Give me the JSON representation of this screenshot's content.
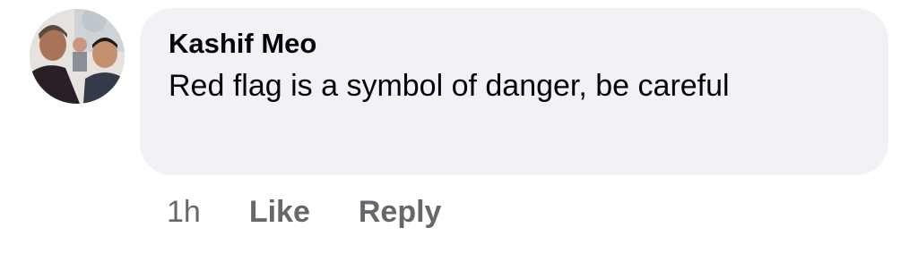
{
  "comment": {
    "avatar_icon": "profile-photo-icon",
    "author": "Kashif Meo",
    "text": "Red flag is a symbol of danger, be careful",
    "timestamp": "1h",
    "actions": {
      "like_label": "Like",
      "reply_label": "Reply"
    }
  },
  "colors": {
    "bubble_background": "#f0f2f5",
    "text": "#050505",
    "secondary_text": "#65676b"
  }
}
